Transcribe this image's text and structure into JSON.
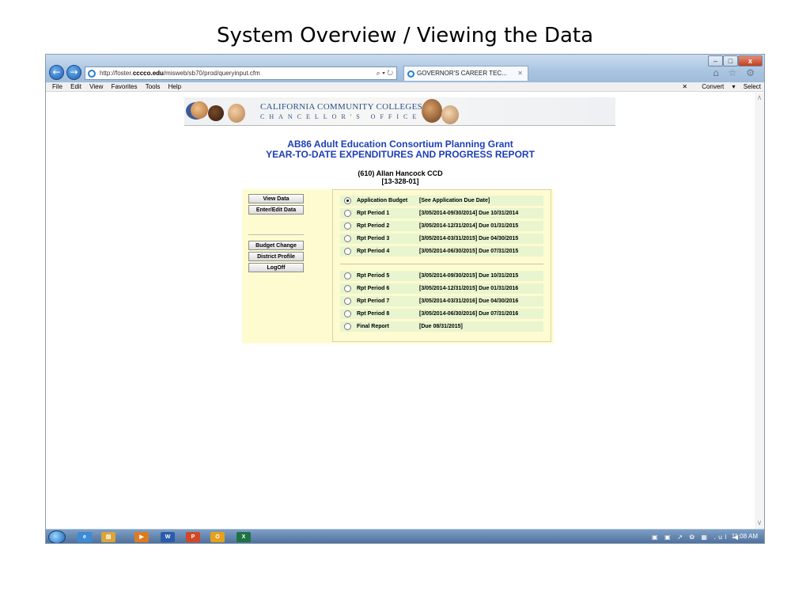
{
  "slide": {
    "title": "System Overview / Viewing the Data"
  },
  "browser": {
    "address_prefix": "http://foster.",
    "address_domain": "cccco.edu",
    "address_suffix": "/misweb/sb70/prod/queryinput.cfm",
    "address_controls": "⌕ ▾ ↻",
    "tab_title": "GOVERNOR'S CAREER TEC...",
    "tab_close": "✕",
    "window_min": "–",
    "window_max": "□",
    "window_close": "x",
    "toolbar_icons": "⌂ ☆ ⚙"
  },
  "menubar": {
    "items": [
      "File",
      "Edit",
      "View",
      "Favorites",
      "Tools",
      "Help"
    ],
    "close_glyph": "✕",
    "convert_label": "Convert",
    "convert_arrow": "▾",
    "select_label": "Select"
  },
  "scroll": {
    "up": "∧",
    "down": "∨"
  },
  "banner": {
    "line1": "CALIFORNIA COMMUNITY COLLEGES",
    "line2": "CHANCELLOR'S OFFICE"
  },
  "report": {
    "title1": "AB86 Adult Education Consortium Planning Grant",
    "title2": "YEAR-TO-DATE EXPENDITURES AND PROGRESS REPORT",
    "college": "(610)  Allan Hancock CCD",
    "code": "[13-328-01]"
  },
  "side_nav": {
    "view_data": "View Data",
    "enter_edit": "Enter/Edit Data",
    "budget_change": "Budget Change",
    "district_profile": "District Profile",
    "logoff": "LogOff"
  },
  "options": [
    {
      "label": "Application Budget",
      "dates": "[See Application Due Date]",
      "selected": true
    },
    {
      "label": "Rpt Period 1",
      "dates": "[3/05/2014-09/30/2014] Due 10/31/2014",
      "selected": false
    },
    {
      "label": "Rpt Period 2",
      "dates": "[3/05/2014-12/31/2014] Due 01/31/2015",
      "selected": false
    },
    {
      "label": "Rpt Period 3",
      "dates": "[3/05/2014-03/31/2015] Due 04/30/2015",
      "selected": false
    },
    {
      "label": "Rpt Period 4",
      "dates": "[3/05/2014-06/30/2015] Due 07/31/2015",
      "selected": false
    },
    {
      "label": "Rpt Period 5",
      "dates": "[3/05/2014-09/30/2015] Due 10/31/2015",
      "selected": false
    },
    {
      "label": "Rpt Period 6",
      "dates": "[3/05/2014-12/31/2015] Due 01/31/2016",
      "selected": false
    },
    {
      "label": "Rpt Period 7",
      "dates": "[3/05/2014-03/31/2016] Due 04/30/2016",
      "selected": false
    },
    {
      "label": "Rpt Period 8",
      "dates": "[3/05/2014-06/30/2016] Due 07/31/2016",
      "selected": false
    },
    {
      "label": "Final Report",
      "dates": "[Due 08/31/2015]",
      "selected": false
    }
  ],
  "taskbar": {
    "apps": [
      {
        "name": "ie",
        "glyph": "e",
        "color": "#3c8ad8"
      },
      {
        "name": "folder",
        "glyph": "▤",
        "color": "#d9a53a"
      },
      {
        "name": "media",
        "glyph": "▶",
        "color": "#e07a1f"
      },
      {
        "name": "word",
        "glyph": "W",
        "color": "#2b5caa"
      },
      {
        "name": "powerpoint",
        "glyph": "P",
        "color": "#d24726"
      },
      {
        "name": "outlook",
        "glyph": "O",
        "color": "#e5a11b"
      },
      {
        "name": "excel",
        "glyph": "X",
        "color": "#1f7244"
      }
    ],
    "tray": "▣ ▣ ↗ ⭗ ▦ .ul ◀",
    "clock": "11:08 AM"
  }
}
